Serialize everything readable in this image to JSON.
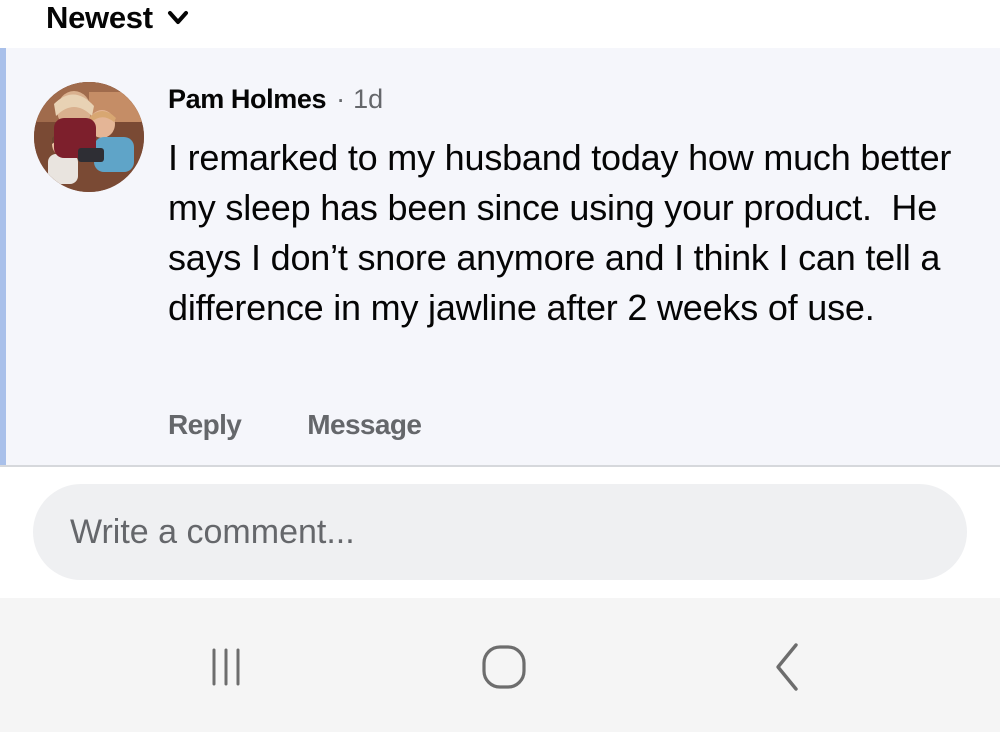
{
  "sort": {
    "label": "Newest",
    "icon": "chevron-down-icon"
  },
  "comment": {
    "author": "Pam Holmes",
    "separator": "·",
    "time": "1d",
    "text": "I remarked to my husband today how much better my sleep has been since using your product.  He says I don’t snore anymore and I think I can tell a difference in my jawline after 2 weeks of use.",
    "actions": {
      "reply": "Reply",
      "message": "Message"
    },
    "highlight_color": "#a9c0ea"
  },
  "composer": {
    "placeholder": "Write a comment..."
  },
  "navbar": {
    "icons": [
      "recent-apps-icon",
      "home-icon",
      "back-icon"
    ]
  }
}
